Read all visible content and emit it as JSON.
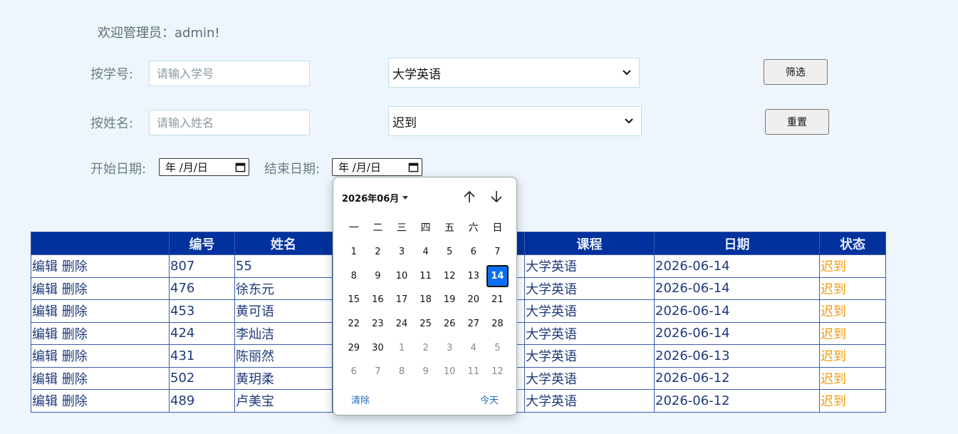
{
  "header": {
    "welcome": "欢迎管理员：admin!"
  },
  "filters": {
    "student_id_label": "按学号:",
    "student_id_placeholder": "请输入学号",
    "name_label": "按姓名:",
    "name_placeholder": "请输入姓名",
    "course_selected": "大学英语",
    "status_selected": "迟到",
    "filter_button": "筛选",
    "reset_button": "重置",
    "start_date_label": "开始日期:",
    "end_date_label": "结束日期:",
    "date_placeholder": "年 /月/日"
  },
  "table": {
    "headers": [
      "",
      "编号",
      "姓名",
      "",
      "课程",
      "日期",
      "状态"
    ],
    "edit_label": "编辑",
    "delete_label": "删除",
    "rows": [
      {
        "id": "807",
        "name": "55",
        "course": "大学英语",
        "date": "2026-06-14",
        "status": "迟到"
      },
      {
        "id": "476",
        "name": "徐东元",
        "course": "大学英语",
        "date": "2026-06-14",
        "status": "迟到"
      },
      {
        "id": "453",
        "name": "黄可语",
        "course": "大学英语",
        "date": "2026-06-14",
        "status": "迟到"
      },
      {
        "id": "424",
        "name": "李灿洁",
        "course": "大学英语",
        "date": "2026-06-14",
        "status": "迟到"
      },
      {
        "id": "431",
        "name": "陈丽然",
        "course": "大学英语",
        "date": "2026-06-13",
        "status": "迟到"
      },
      {
        "id": "502",
        "name": "黄玥柔",
        "course": "大学英语",
        "date": "2026-06-12",
        "status": "迟到"
      },
      {
        "id": "489",
        "name": "卢美宝",
        "course": "大学英语",
        "date": "2026-06-12",
        "status": "迟到"
      }
    ]
  },
  "datepicker": {
    "month_label": "2026年06月",
    "weekdays": [
      "一",
      "二",
      "三",
      "四",
      "五",
      "六",
      "日"
    ],
    "days": [
      {
        "d": "1"
      },
      {
        "d": "2"
      },
      {
        "d": "3"
      },
      {
        "d": "4"
      },
      {
        "d": "5"
      },
      {
        "d": "6"
      },
      {
        "d": "7"
      },
      {
        "d": "8"
      },
      {
        "d": "9"
      },
      {
        "d": "10"
      },
      {
        "d": "11"
      },
      {
        "d": "12"
      },
      {
        "d": "13"
      },
      {
        "d": "14",
        "selected": true
      },
      {
        "d": "15"
      },
      {
        "d": "16"
      },
      {
        "d": "17"
      },
      {
        "d": "18"
      },
      {
        "d": "19"
      },
      {
        "d": "20"
      },
      {
        "d": "21"
      },
      {
        "d": "22"
      },
      {
        "d": "23"
      },
      {
        "d": "24"
      },
      {
        "d": "25"
      },
      {
        "d": "26"
      },
      {
        "d": "27"
      },
      {
        "d": "28"
      },
      {
        "d": "29"
      },
      {
        "d": "30"
      },
      {
        "d": "1",
        "other": true
      },
      {
        "d": "2",
        "other": true
      },
      {
        "d": "3",
        "other": true
      },
      {
        "d": "4",
        "other": true
      },
      {
        "d": "5",
        "other": true
      },
      {
        "d": "6",
        "other": true
      },
      {
        "d": "7",
        "other": true
      },
      {
        "d": "8",
        "other": true
      },
      {
        "d": "9",
        "other": true
      },
      {
        "d": "10",
        "other": true
      },
      {
        "d": "11",
        "other": true
      },
      {
        "d": "12",
        "other": true
      }
    ],
    "clear_label": "清除",
    "today_label": "今天"
  },
  "colors": {
    "header_bg": "#00319c",
    "status_text": "#f39c12",
    "selected_day": "#0b6ff2",
    "page_bg": "#eef5fd"
  }
}
